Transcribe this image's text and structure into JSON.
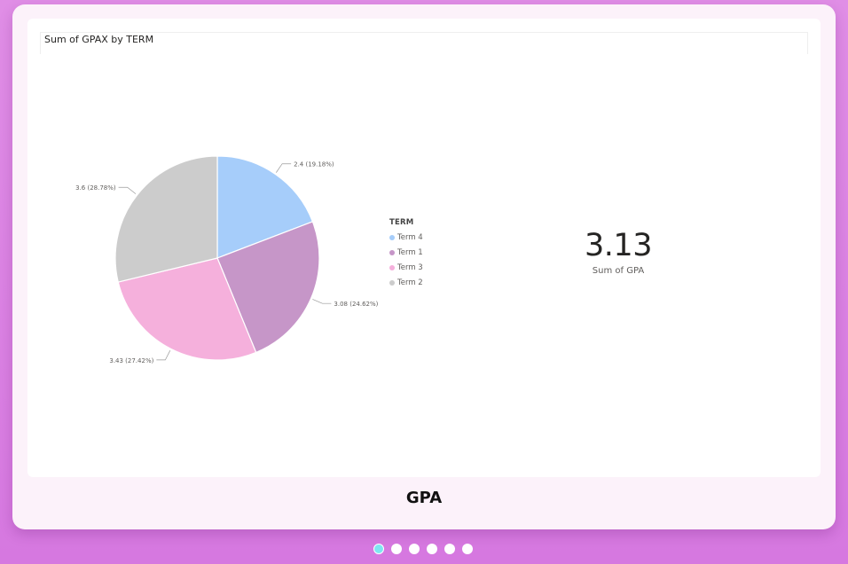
{
  "slide": {
    "caption": "GPA"
  },
  "report": {
    "chart_title": "Sum of GPAX by TERM",
    "legend_title": "TERM",
    "kpi": {
      "value": "3.13",
      "label": "Sum of GPA"
    }
  },
  "chart_data": {
    "type": "pie",
    "title": "Sum of GPAX by TERM",
    "legend_title": "TERM",
    "slices": [
      {
        "label": "Term 4",
        "value": 2.4,
        "percent": 19.18,
        "data_label": "2.4 (19.18%)",
        "color": "#a6cdfa"
      },
      {
        "label": "Term 1",
        "value": 3.08,
        "percent": 24.62,
        "data_label": "3.08 (24.62%)",
        "color": "#c696c8"
      },
      {
        "label": "Term 3",
        "value": 3.43,
        "percent": 27.42,
        "data_label": "3.43 (27.42%)",
        "color": "#f5b0dc"
      },
      {
        "label": "Term 2",
        "value": 3.6,
        "percent": 28.78,
        "data_label": "3.6 (28.78%)",
        "color": "#cccccc"
      }
    ],
    "legend_position": "right"
  },
  "pagination": {
    "count": 6,
    "active_index": 0
  }
}
